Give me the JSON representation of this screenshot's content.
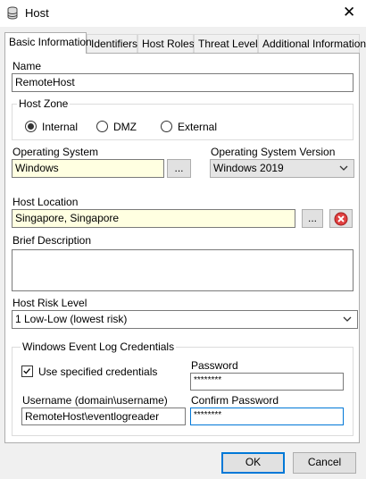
{
  "window": {
    "title": "Host",
    "close_glyph": "✕",
    "app_icon": "database-icon",
    "close_icon": "close-icon"
  },
  "tabs": [
    {
      "label": "Basic Information",
      "active": true
    },
    {
      "label": "Identifiers"
    },
    {
      "label": "Host Roles"
    },
    {
      "label": "Threat Level"
    },
    {
      "label": "Additional Information"
    }
  ],
  "name": {
    "label": "Name",
    "value": "RemoteHost"
  },
  "host_zone": {
    "label": "Host Zone",
    "options": [
      {
        "label": "Internal",
        "selected": true
      },
      {
        "label": "DMZ",
        "selected": false
      },
      {
        "label": "External",
        "selected": false
      }
    ]
  },
  "os": {
    "label": "Operating System",
    "value": "Windows",
    "browse_label": "..."
  },
  "os_version": {
    "label": "Operating System Version",
    "value": "Windows 2019"
  },
  "location": {
    "label": "Host Location",
    "value": "Singapore, Singapore",
    "browse_label": "...",
    "clear_icon": "clear-icon"
  },
  "description": {
    "label": "Brief Description",
    "value": ""
  },
  "risk": {
    "label": "Host Risk Level",
    "value": "1 Low-Low (lowest risk)"
  },
  "credentials": {
    "group_label": "Windows Event Log Credentials",
    "use_specified_label": "Use specified credentials",
    "use_specified_checked": true,
    "password_label": "Password",
    "password_value": "********",
    "username_label": "Username (domain\\username)",
    "username_value": "RemoteHost\\eventlogreader",
    "confirm_label": "Confirm Password",
    "confirm_value": "********"
  },
  "buttons": {
    "ok": "OK",
    "cancel": "Cancel"
  },
  "colors": {
    "required_bg": "#ffffe1",
    "focus_border": "#0078d7",
    "clear_red": "#e04040"
  }
}
